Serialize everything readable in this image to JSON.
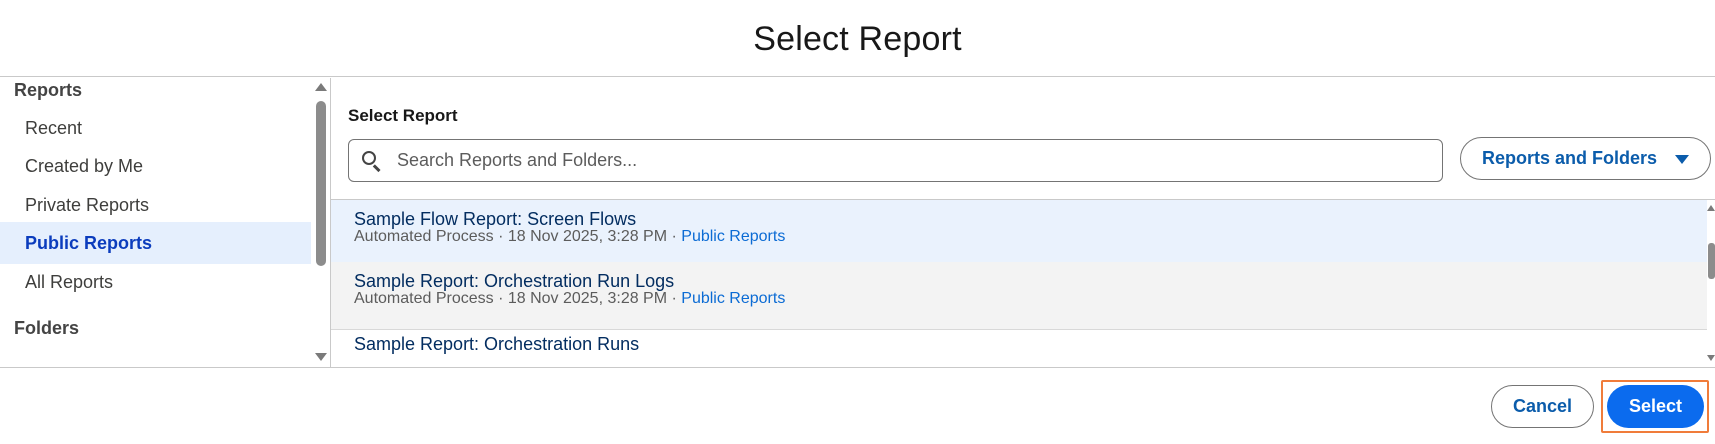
{
  "modal": {
    "title": "Select Report"
  },
  "sidebar": {
    "section_reports": "Reports",
    "items": [
      {
        "label": "Recent"
      },
      {
        "label": "Created by Me"
      },
      {
        "label": "Private Reports"
      },
      {
        "label": "Public Reports",
        "active": true
      },
      {
        "label": "All Reports"
      }
    ],
    "section_folders": "Folders"
  },
  "main": {
    "title": "Select Report",
    "search": {
      "placeholder": "Search Reports and Folders...",
      "value": ""
    },
    "filter_button": {
      "label": "Reports and Folders",
      "icon": "caret-down-icon"
    }
  },
  "list": {
    "items": [
      {
        "name": "Sample Flow Report: Screen Flows",
        "owner": "Automated Process",
        "date": "18 Nov 2025, 3:28 PM",
        "folder": "Public Reports",
        "state": "selected"
      },
      {
        "name": "Sample Report: Orchestration Run Logs",
        "owner": "Automated Process",
        "date": "18 Nov 2025, 3:28 PM",
        "folder": "Public Reports",
        "state": "hover"
      },
      {
        "name": "Sample Report: Orchestration Runs",
        "owner": "",
        "date": "",
        "folder": "",
        "state": ""
      }
    ],
    "separator": " · "
  },
  "footer": {
    "cancel_label": "Cancel",
    "select_label": "Select"
  },
  "colors": {
    "accent": "#0b6bee",
    "link": "#0b6bd4",
    "active_bg": "#e5effd",
    "focus_ring": "#f07c3a"
  }
}
